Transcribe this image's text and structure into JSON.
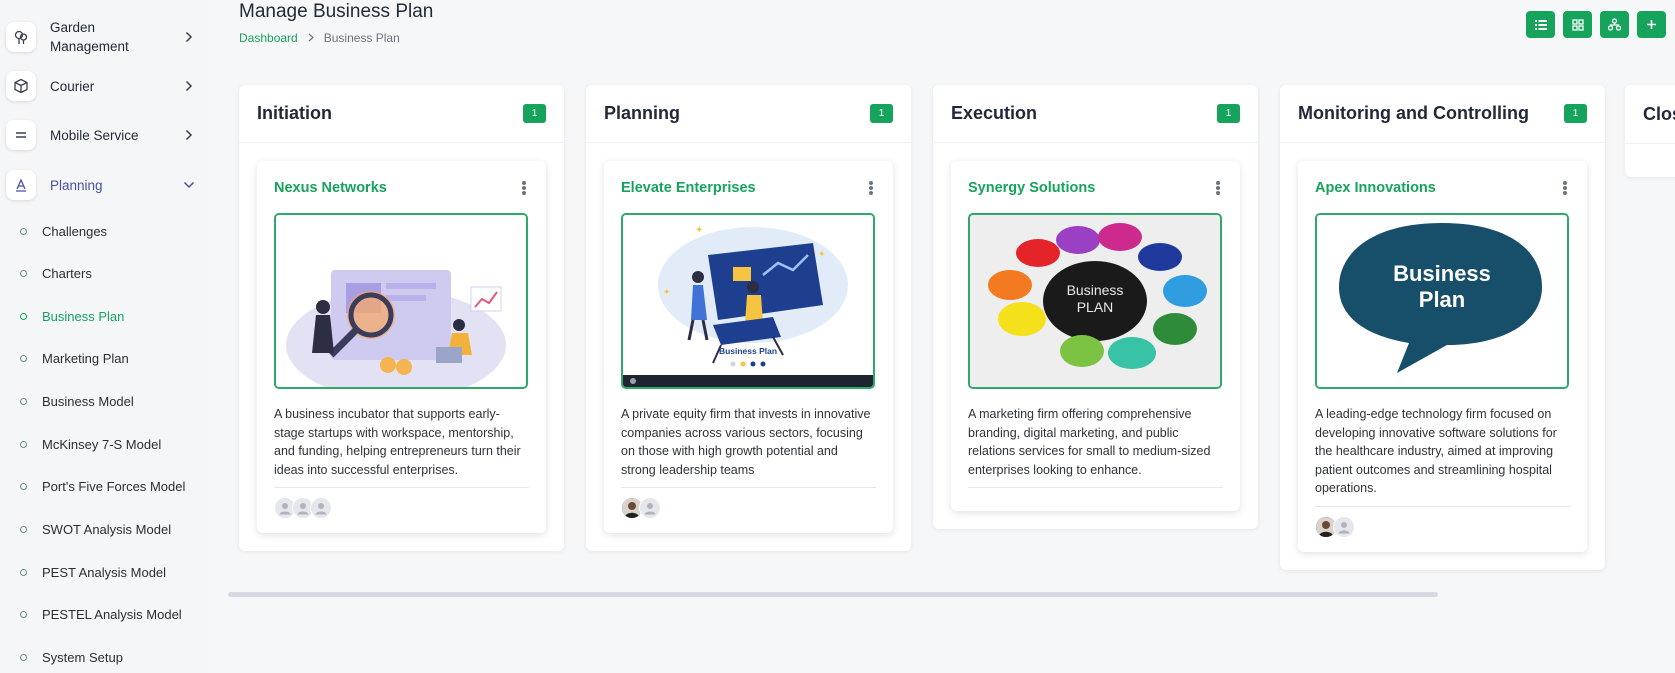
{
  "sidebar": {
    "top_items": [
      {
        "label": "Garden Management",
        "icon": "plant-icon"
      },
      {
        "label": "Courier",
        "icon": "box-icon"
      },
      {
        "label": "Mobile Service",
        "icon": "menu-lines-icon"
      },
      {
        "label": "Planning",
        "icon": "letter-a-icon"
      }
    ],
    "sub_items": [
      {
        "label": "Challenges"
      },
      {
        "label": "Charters"
      },
      {
        "label": "Business Plan"
      },
      {
        "label": "Marketing Plan"
      },
      {
        "label": "Business Model"
      },
      {
        "label": "McKinsey 7-S Model"
      },
      {
        "label": "Port's Five Forces Model"
      },
      {
        "label": "SWOT Analysis Model"
      },
      {
        "label": "PEST Analysis Model"
      },
      {
        "label": "PESTEL Analysis Model"
      },
      {
        "label": "System Setup"
      }
    ],
    "active_sub": "Business Plan"
  },
  "header": {
    "title": "Manage Business Plan",
    "breadcrumb": {
      "home": "Dashboard",
      "current": "Business Plan"
    },
    "toolbar": [
      "list-view-icon",
      "grid-view-icon",
      "tree-view-icon",
      "plus-icon"
    ]
  },
  "colors": {
    "accent": "#16a35c",
    "active_nav": "#4b4fa8",
    "image_border": "#2fa86a"
  },
  "board": {
    "columns": [
      {
        "title": "Initiation",
        "count": "1",
        "card": {
          "title": "Nexus Networks",
          "description": "A business incubator that supports early-stage startups with workspace, mentorship, and funding, helping entrepreneurs turn their ideas into successful enterprises.",
          "avatars": [
            "placeholder",
            "placeholder",
            "placeholder"
          ]
        }
      },
      {
        "title": "Planning",
        "count": "1",
        "card": {
          "title": "Elevate Enterprises",
          "description": "A private equity firm that invests in innovative companies across various sectors, focusing on those with high growth potential and strong leadership teams",
          "image_text": "Business Plan",
          "avatars": [
            "photo",
            "placeholder"
          ]
        }
      },
      {
        "title": "Execution",
        "count": "1",
        "card": {
          "title": "Synergy Solutions",
          "description": "A marketing firm offering comprehensive branding, digital marketing, and public relations services for small to medium-sized enterprises looking to enhance.",
          "image_text": [
            "Business",
            "PLAN"
          ],
          "avatars": []
        }
      },
      {
        "title": "Monitoring and Controlling",
        "count": "1",
        "card": {
          "title": "Apex Innovations",
          "description": "A leading-edge technology firm focused on developing innovative software solutions for the healthcare industry, aimed at improving patient outcomes and streamlining hospital operations.",
          "image_text": [
            "Business",
            "Plan"
          ],
          "avatars": [
            "photo",
            "placeholder"
          ]
        }
      }
    ],
    "partial_column_title": "Clos"
  }
}
